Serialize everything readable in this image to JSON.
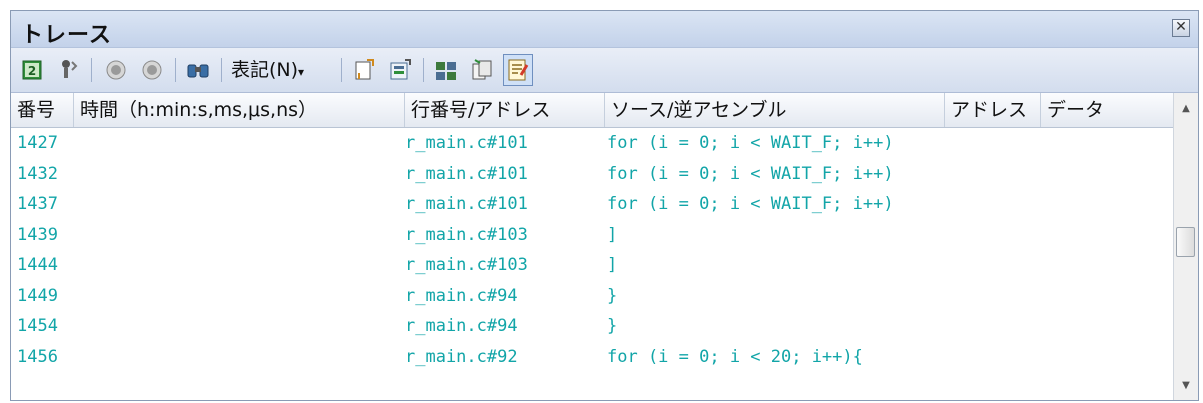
{
  "window": {
    "title": "トレース"
  },
  "toolbar": {
    "icons": [
      "refresh-icon",
      "filter-icon",
      "step-back-icon",
      "step-forward-icon",
      "find-icon",
      "jump-to-source-icon",
      "jump-to-disasm-icon",
      "mixed-view-icon",
      "copy-icon",
      "show-all-icon"
    ],
    "notation_label": "表記(N)",
    "dropdown_glyph": "▾"
  },
  "table": {
    "columns": [
      "番号",
      "時間（h:min:s,ms,μs,ns）",
      "行番号/アドレス",
      "ソース/逆アセンブル",
      "アドレス",
      "データ"
    ],
    "rows": [
      {
        "no": "1427",
        "addr": "r_main.c#101",
        "src": "for (i = 0; i < WAIT_F; i++)"
      },
      {
        "no": "1432",
        "addr": "r_main.c#101",
        "src": "for (i = 0; i < WAIT_F; i++)"
      },
      {
        "no": "1437",
        "addr": "r_main.c#101",
        "src": "for (i = 0; i < WAIT_F; i++)"
      },
      {
        "no": "1439",
        "addr": "r_main.c#103",
        "src": "]"
      },
      {
        "no": "1444",
        "addr": "r_main.c#103",
        "src": "]"
      },
      {
        "no": "1449",
        "addr": "r_main.c#94",
        "src": "}"
      },
      {
        "no": "1454",
        "addr": "r_main.c#94",
        "src": "}"
      },
      {
        "no": "1456",
        "addr": "r_main.c#92",
        "src": "for (i = 0; i < 20; i++){"
      }
    ]
  },
  "colors": {
    "row_text": "#12a5a8",
    "panel_bg": "#d6e0f0"
  },
  "scrollbar": {
    "up_glyph": "▲",
    "down_glyph": "▼"
  }
}
